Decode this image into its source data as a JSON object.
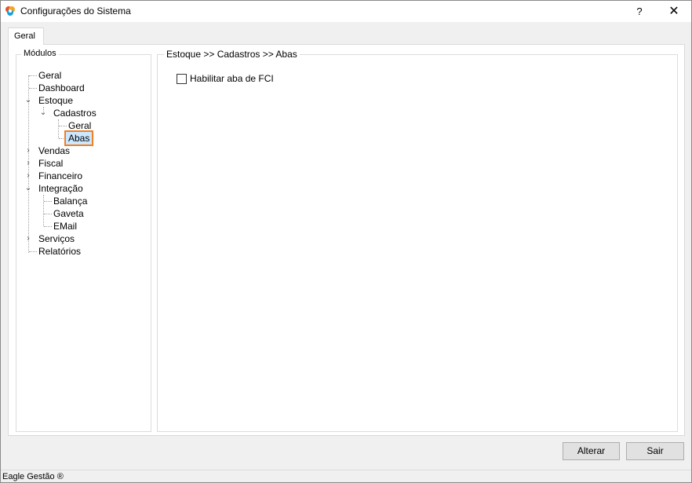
{
  "window": {
    "title": "Configurações do Sistema",
    "help_label": "?",
    "close_label": "✕"
  },
  "tabs": [
    {
      "label": "Geral",
      "selected": true
    }
  ],
  "modules": {
    "title": "Módulos",
    "tree": [
      {
        "label": "Geral"
      },
      {
        "label": "Dashboard"
      },
      {
        "label": "Estoque",
        "expanded": true
      },
      {
        "label": "Cadastros",
        "expanded": true
      },
      {
        "label": "Geral"
      },
      {
        "label": "Abas",
        "selected": true
      },
      {
        "label": "Vendas",
        "expanded": false
      },
      {
        "label": "Fiscal",
        "expanded": false
      },
      {
        "label": "Financeiro",
        "expanded": false
      },
      {
        "label": "Integração",
        "expanded": true
      },
      {
        "label": "Balança"
      },
      {
        "label": "Gaveta"
      },
      {
        "label": "EMail"
      },
      {
        "label": "Serviços",
        "expanded": false
      },
      {
        "label": "Relatórios"
      }
    ]
  },
  "panel": {
    "title": "Estoque >> Cadastros >> Abas",
    "checkbox_label": "Habilitar aba de FCI",
    "checkbox_checked": false
  },
  "buttons": {
    "alterar": "Alterar",
    "sair": "Sair"
  },
  "status": {
    "text": "Eagle Gestão ®"
  },
  "colors": {
    "selection_bg": "#cce8ff",
    "highlight_border": "#f07f25"
  }
}
